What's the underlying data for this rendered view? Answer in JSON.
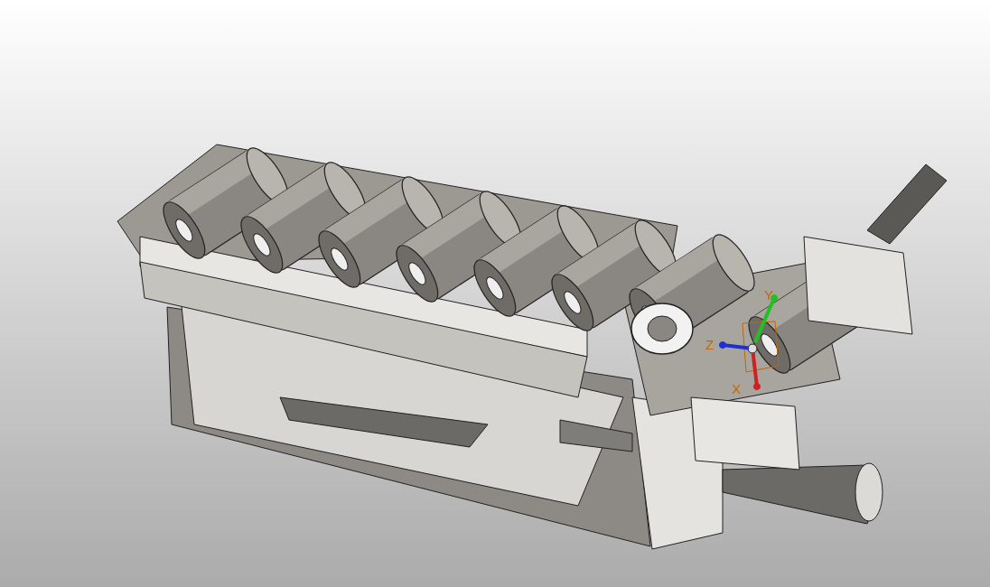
{
  "viewport": {
    "triad": {
      "axes": [
        {
          "label": "Y",
          "color": "#22c022"
        },
        {
          "label": "Z",
          "color": "#2030d0"
        },
        {
          "label": "X",
          "color": "#d02020"
        }
      ]
    }
  }
}
